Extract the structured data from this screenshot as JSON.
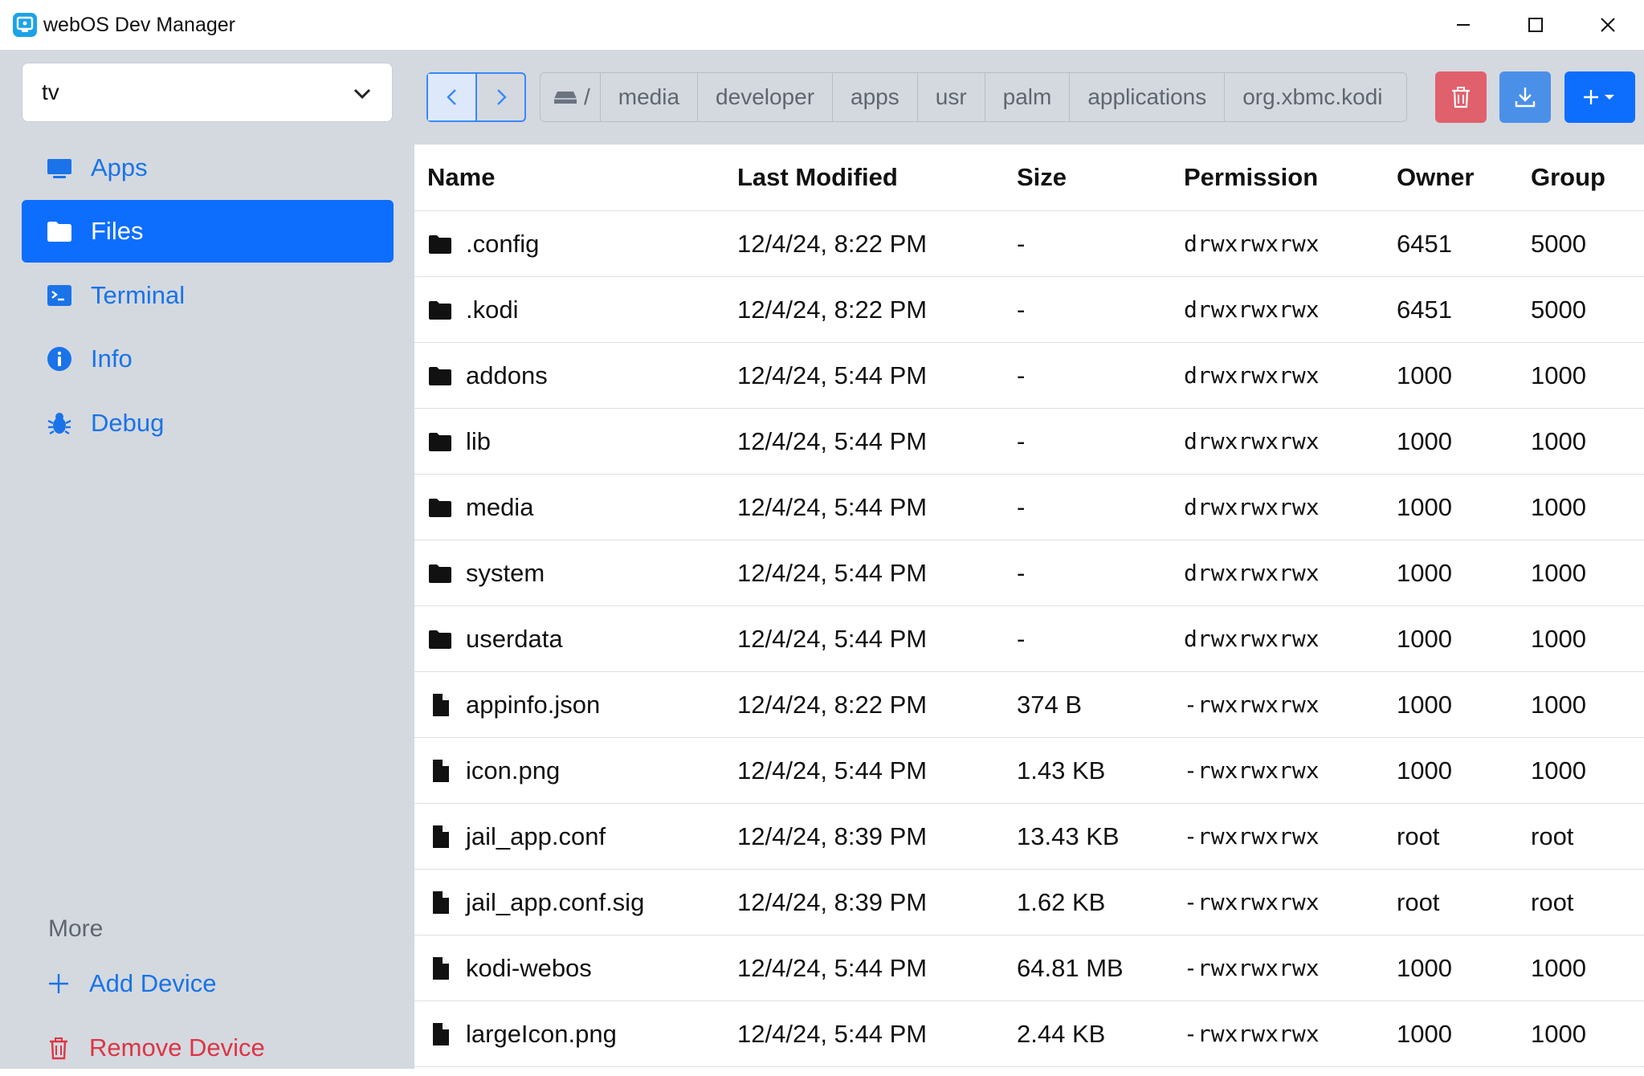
{
  "window": {
    "title": "webOS Dev Manager",
    "controls": [
      "minimize",
      "maximize",
      "close"
    ]
  },
  "sidebar": {
    "device": "tv",
    "nav": [
      {
        "label": "Apps",
        "icon": "monitor-icon",
        "active": false
      },
      {
        "label": "Files",
        "icon": "folder-icon",
        "active": true
      },
      {
        "label": "Terminal",
        "icon": "terminal-icon",
        "active": false
      },
      {
        "label": "Info",
        "icon": "info-icon",
        "active": false
      },
      {
        "label": "Debug",
        "icon": "bug-icon",
        "active": false
      }
    ],
    "more_label": "More",
    "more": [
      {
        "label": "Add Device",
        "icon": "plus-icon",
        "color": "#1a73e8"
      },
      {
        "label": "Remove Device",
        "icon": "trash-icon",
        "color": "#dc3545"
      }
    ]
  },
  "toolbar": {
    "breadcrumb_root": "/",
    "breadcrumb": [
      "media",
      "developer",
      "apps",
      "usr",
      "palm",
      "applications",
      "org.xbmc.kodi"
    ],
    "colors": {
      "delete": "#e0606c",
      "download": "#4a90e8",
      "add": "#0d6efd"
    }
  },
  "table": {
    "columns": [
      "Name",
      "Last Modified",
      "Size",
      "Permission",
      "Owner",
      "Group"
    ],
    "rows": [
      {
        "type": "folder",
        "name": ".config",
        "modified": "12/4/24, 8:22 PM",
        "size": "-",
        "permission": "drwxrwxrwx",
        "owner": "6451",
        "group": "5000"
      },
      {
        "type": "folder",
        "name": ".kodi",
        "modified": "12/4/24, 8:22 PM",
        "size": "-",
        "permission": "drwxrwxrwx",
        "owner": "6451",
        "group": "5000"
      },
      {
        "type": "folder",
        "name": "addons",
        "modified": "12/4/24, 5:44 PM",
        "size": "-",
        "permission": "drwxrwxrwx",
        "owner": "1000",
        "group": "1000"
      },
      {
        "type": "folder",
        "name": "lib",
        "modified": "12/4/24, 5:44 PM",
        "size": "-",
        "permission": "drwxrwxrwx",
        "owner": "1000",
        "group": "1000"
      },
      {
        "type": "folder",
        "name": "media",
        "modified": "12/4/24, 5:44 PM",
        "size": "-",
        "permission": "drwxrwxrwx",
        "owner": "1000",
        "group": "1000"
      },
      {
        "type": "folder",
        "name": "system",
        "modified": "12/4/24, 5:44 PM",
        "size": "-",
        "permission": "drwxrwxrwx",
        "owner": "1000",
        "group": "1000"
      },
      {
        "type": "folder",
        "name": "userdata",
        "modified": "12/4/24, 5:44 PM",
        "size": "-",
        "permission": "drwxrwxrwx",
        "owner": "1000",
        "group": "1000"
      },
      {
        "type": "file",
        "name": "appinfo.json",
        "modified": "12/4/24, 8:22 PM",
        "size": "374 B",
        "permission": "-rwxrwxrwx",
        "owner": "1000",
        "group": "1000"
      },
      {
        "type": "file",
        "name": "icon.png",
        "modified": "12/4/24, 5:44 PM",
        "size": "1.43 KB",
        "permission": "-rwxrwxrwx",
        "owner": "1000",
        "group": "1000"
      },
      {
        "type": "file",
        "name": "jail_app.conf",
        "modified": "12/4/24, 8:39 PM",
        "size": "13.43 KB",
        "permission": "-rwxrwxrwx",
        "owner": "root",
        "group": "root"
      },
      {
        "type": "file",
        "name": "jail_app.conf.sig",
        "modified": "12/4/24, 8:39 PM",
        "size": "1.62 KB",
        "permission": "-rwxrwxrwx",
        "owner": "root",
        "group": "root"
      },
      {
        "type": "file",
        "name": "kodi-webos",
        "modified": "12/4/24, 5:44 PM",
        "size": "64.81 MB",
        "permission": "-rwxrwxrwx",
        "owner": "1000",
        "group": "1000"
      },
      {
        "type": "file",
        "name": "largeIcon.png",
        "modified": "12/4/24, 5:44 PM",
        "size": "2.44 KB",
        "permission": "-rwxrwxrwx",
        "owner": "1000",
        "group": "1000"
      }
    ]
  }
}
